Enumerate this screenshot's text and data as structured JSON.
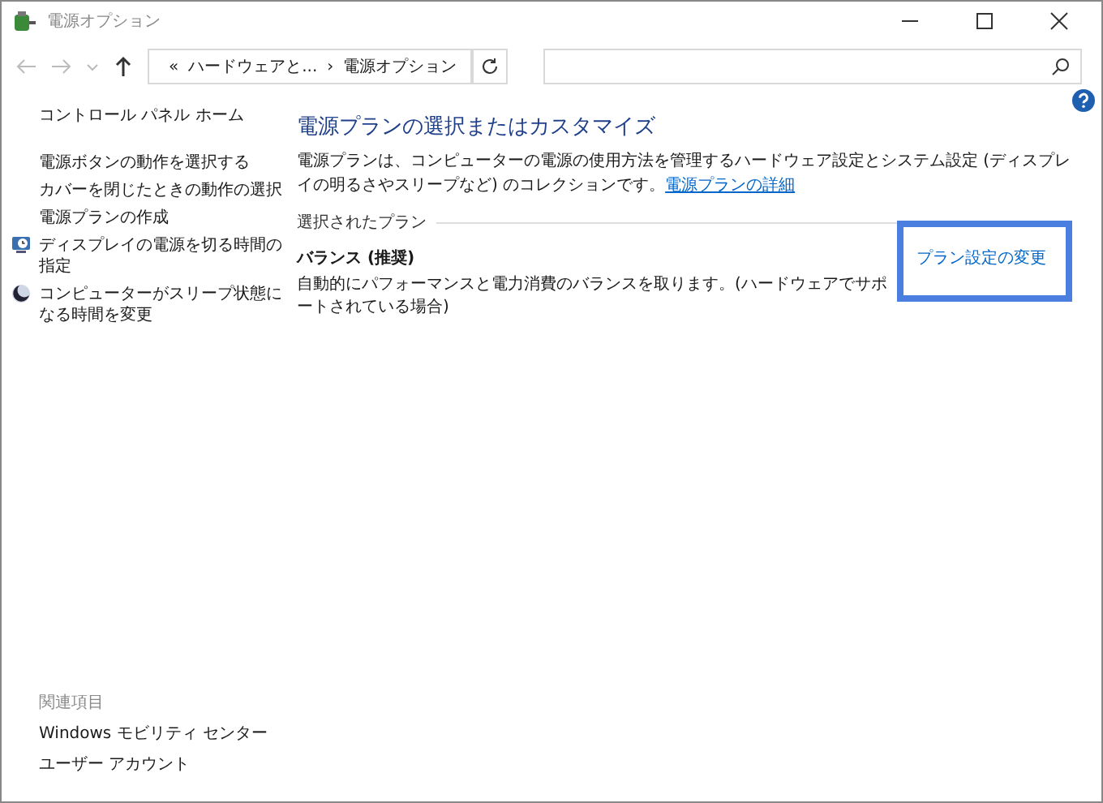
{
  "window": {
    "title": "電源オプション"
  },
  "address_bar": {
    "prefix": "«",
    "crumbs": [
      "ハードウェアと...",
      "電源オプション"
    ],
    "separator": "›"
  },
  "sidebar": {
    "home": "コントロール パネル ホーム",
    "items": [
      {
        "label": "電源ボタンの動作を選択する",
        "kind": "plain"
      },
      {
        "label": "カバーを閉じたときの動作の選択",
        "kind": "plain"
      },
      {
        "label": "電源プランの作成",
        "kind": "plain"
      },
      {
        "label": "ディスプレイの電源を切る時間の指定",
        "kind": "display"
      },
      {
        "label": "コンピューターがスリープ状態になる時間を変更",
        "kind": "sleep"
      }
    ],
    "related_title": "関連項目",
    "related": [
      "Windows モビリティ センター",
      "ユーザー アカウント"
    ]
  },
  "main": {
    "heading": "電源プランの選択またはカスタマイズ",
    "description": "電源プランは、コンピューターの電源の使用方法を管理するハードウェア設定とシステム設定 (ディスプレイの明るさやスリープなど) のコレクションです。",
    "details_link": "電源プランの詳細",
    "group_label": "選択されたプラン",
    "plans": [
      {
        "name": "バランス (推奨)",
        "description": "自動的にパフォーマンスと電力消費のバランスを取ります。(ハードウェアでサポートされている場合)",
        "link": "プラン設定の変更",
        "highlighted": true
      }
    ]
  }
}
